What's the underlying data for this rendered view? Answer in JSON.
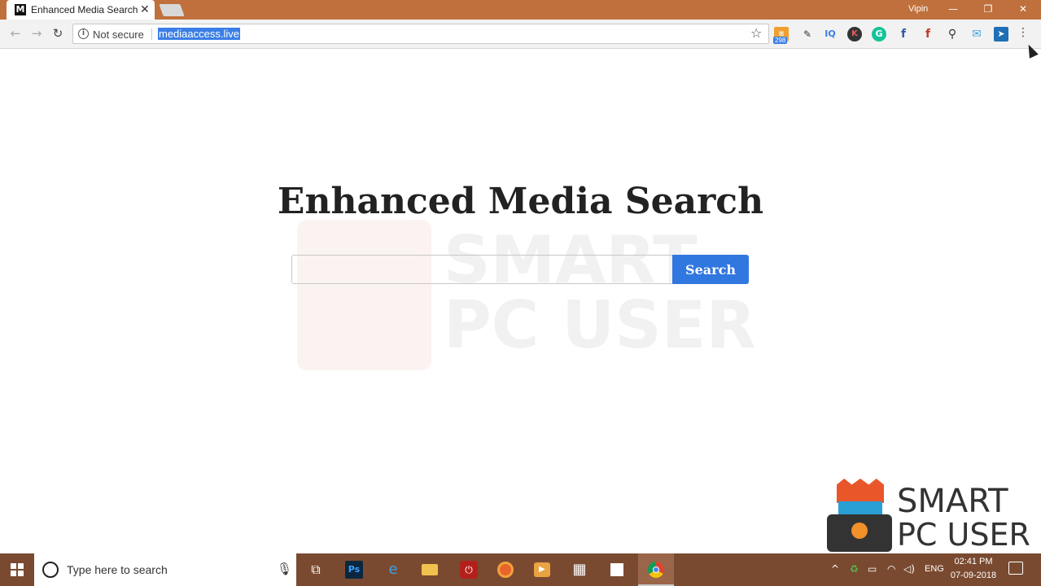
{
  "browser": {
    "tab": {
      "favicon": "M",
      "title": "Enhanced Media Search",
      "close": "✕"
    },
    "profile_name": "Vipin",
    "window_controls": {
      "minimize": "—",
      "restore": "❐",
      "close": "✕"
    },
    "toolbar": {
      "back": "←",
      "forward": "→",
      "reload": "↻",
      "security_label": "Not secure",
      "url": "mediaaccess.live",
      "bookmark_star": "☆",
      "menu": "⋮",
      "extensions": [
        {
          "name": "rss-feed-icon",
          "glyph": "≋",
          "badge": "298"
        },
        {
          "name": "pen-tool-icon",
          "glyph": "✎"
        },
        {
          "name": "iq-icon",
          "glyph": "IQ"
        },
        {
          "name": "k-extension-icon",
          "glyph": "K"
        },
        {
          "name": "grammarly-icon",
          "glyph": "G"
        },
        {
          "name": "facebook-icon",
          "glyph": "f"
        },
        {
          "name": "f-red-extension-icon",
          "glyph": "f"
        },
        {
          "name": "magnifier-icon",
          "glyph": "⚲"
        },
        {
          "name": "mail-icon",
          "glyph": "✉"
        },
        {
          "name": "send-icon",
          "glyph": "➤"
        }
      ]
    }
  },
  "page": {
    "heading": "Enhanced Media Search",
    "search_value": "",
    "search_button": "Search",
    "watermark_text_1": "SMART",
    "watermark_text_2": "PC USER"
  },
  "corner_logo": {
    "line1": "SMART",
    "line2": "PC USER"
  },
  "taskbar": {
    "search_placeholder": "Type here to search",
    "mic": "🎙",
    "task_view": "⧉",
    "apps": {
      "photoshop": "Ps",
      "edge": "e",
      "power": "⏻",
      "media": "▶",
      "calculator": "▦"
    },
    "tray": {
      "up": "^",
      "recycle": "♻",
      "battery": "▭",
      "wifi": "◠",
      "volume": "◁)",
      "language": "ENG"
    },
    "clock": {
      "time": "02:41 PM",
      "date": "07-09-2018"
    }
  },
  "colors": {
    "titlebar": "#c0703c",
    "accent_blue": "#3177e0",
    "taskbar": "#7a4a30"
  }
}
